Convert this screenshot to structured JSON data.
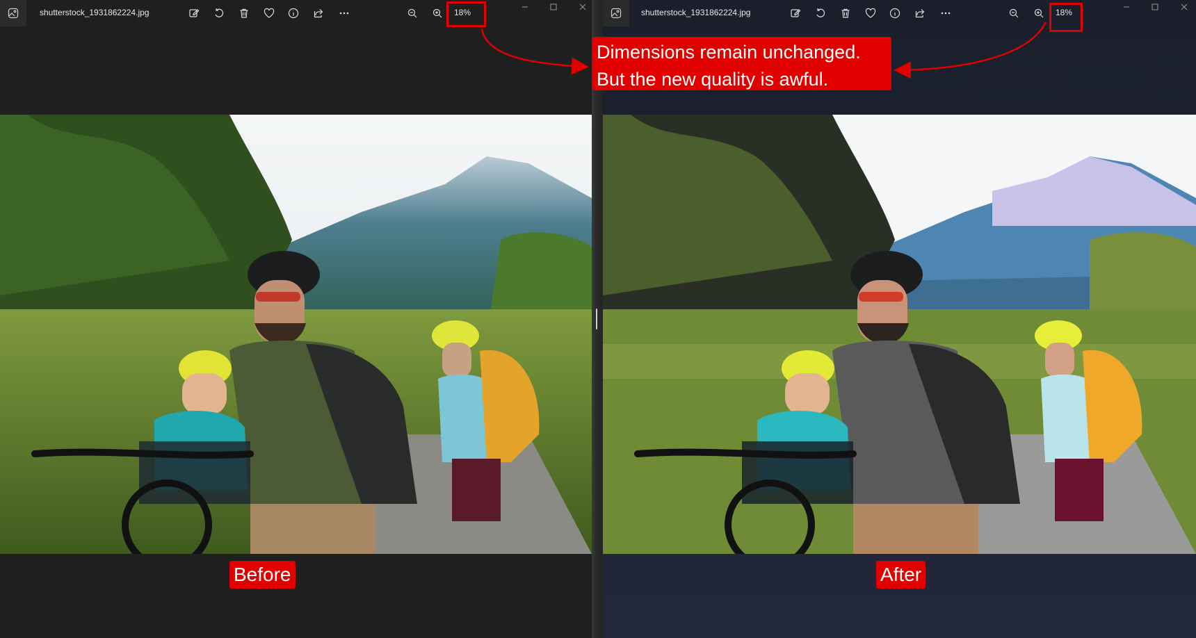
{
  "left_window": {
    "file_name": "shutterstock_1931862224.jpg",
    "zoom_level": "18%",
    "caption": "Before"
  },
  "right_window": {
    "file_name": "shutterstock_1931862224.jpg",
    "zoom_level": "18%",
    "caption": "After"
  },
  "callout": {
    "line1": "Dimensions remain unchanged.",
    "line2": "But the new quality is awful."
  },
  "toolbar_icons": [
    "edit-icon",
    "rotate-icon",
    "delete-icon",
    "favorite-icon",
    "info-icon",
    "share-icon",
    "more-icon",
    "zoom-out-icon",
    "zoom-in-icon"
  ],
  "window_controls": [
    "minimize-icon",
    "maximize-icon",
    "close-icon"
  ],
  "colors": {
    "annotation_red": "#e10000",
    "left_background": "#1f1f1f",
    "right_background": "#1c2232"
  }
}
